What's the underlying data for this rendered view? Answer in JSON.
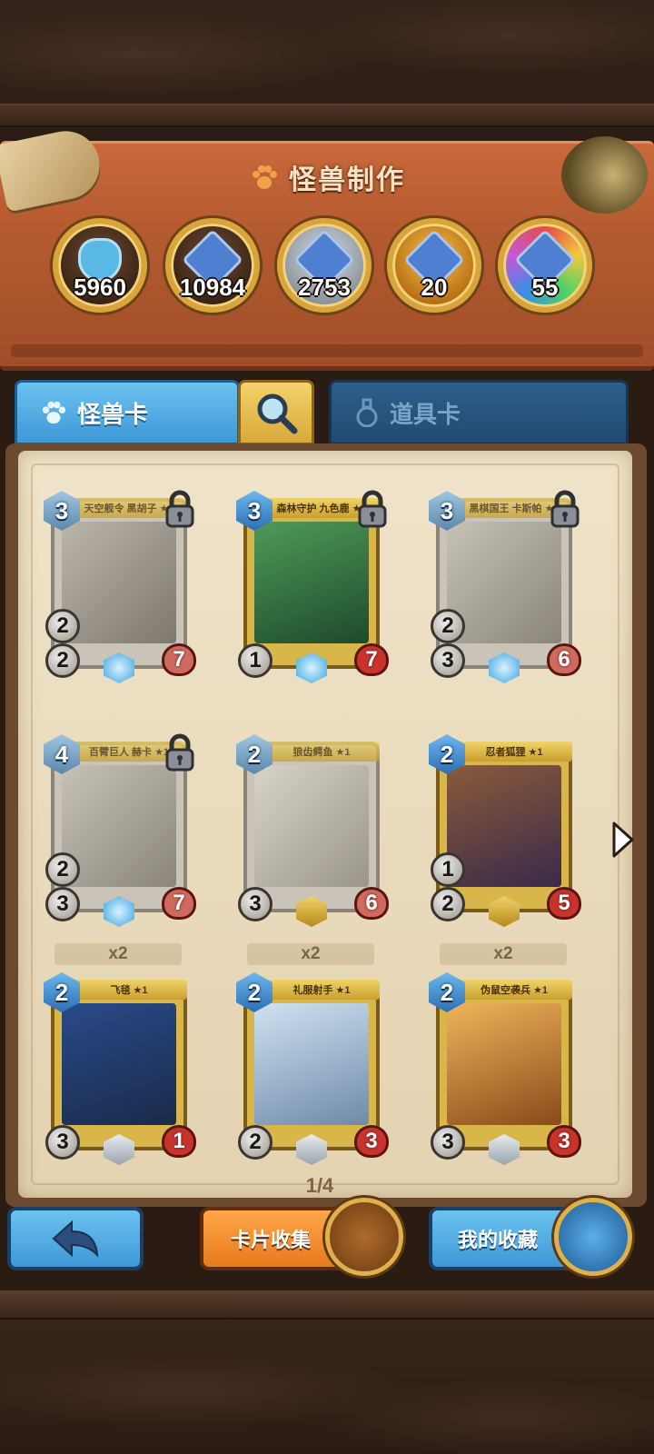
{
  "header": {
    "title": "怪兽制作",
    "title_icon": "paw-icon"
  },
  "resources": [
    {
      "name": "dust-bottle",
      "value": "5960",
      "color": "#5ab8e6"
    },
    {
      "name": "common-gem",
      "value": "10984",
      "color": "#7f8e9a"
    },
    {
      "name": "rare-gem",
      "value": "2753",
      "color": "#c9ced4"
    },
    {
      "name": "epic-gem",
      "value": "20",
      "color": "#f0a82a"
    },
    {
      "name": "legendary-gem",
      "value": "55",
      "color": "#c658d6"
    }
  ],
  "tabs": {
    "monster_label": "怪兽卡",
    "item_label": "道具卡",
    "search_icon": "magnifier-icon"
  },
  "cards": [
    {
      "name": "天空舰令 黑胡子 ★1",
      "cost": "3",
      "atk": "2",
      "spd": "2",
      "hp": "7",
      "locked": true,
      "owned": false,
      "copies": ""
    },
    {
      "name": "森林守护 九色鹿 ★1",
      "cost": "3",
      "atk": "",
      "spd": "1",
      "hp": "7",
      "locked": true,
      "owned": true,
      "copies": ""
    },
    {
      "name": "黑棋国王 卡斯帕 ★1",
      "cost": "3",
      "atk": "2",
      "spd": "3",
      "hp": "6",
      "locked": true,
      "owned": false,
      "copies": ""
    },
    {
      "name": "百臂巨人 赫卡 ★1",
      "cost": "4",
      "atk": "2",
      "spd": "3",
      "hp": "7",
      "locked": true,
      "owned": false,
      "copies": ""
    },
    {
      "name": "狼齿鳄鱼 ★1",
      "cost": "2",
      "atk": "",
      "spd": "3",
      "hp": "6",
      "locked": false,
      "owned": false,
      "copies": ""
    },
    {
      "name": "忍者狐狸 ★1",
      "cost": "2",
      "atk": "1",
      "spd": "2",
      "hp": "5",
      "locked": false,
      "owned": true,
      "copies": ""
    },
    {
      "name": "飞毯 ★1",
      "cost": "2",
      "atk": "",
      "spd": "3",
      "hp": "1",
      "locked": false,
      "owned": true,
      "copies": "x2"
    },
    {
      "name": "礼服射手 ★1",
      "cost": "2",
      "atk": "",
      "spd": "2",
      "hp": "3",
      "locked": false,
      "owned": true,
      "copies": "x2"
    },
    {
      "name": "伪鼠空袭兵 ★1",
      "cost": "2",
      "atk": "",
      "spd": "3",
      "hp": "3",
      "locked": false,
      "owned": true,
      "copies": "x2"
    }
  ],
  "pagination": "1/4",
  "buttons": {
    "back_icon": "back-arrow-icon",
    "collect_label": "卡片收集",
    "favorites_label": "我的收藏"
  }
}
